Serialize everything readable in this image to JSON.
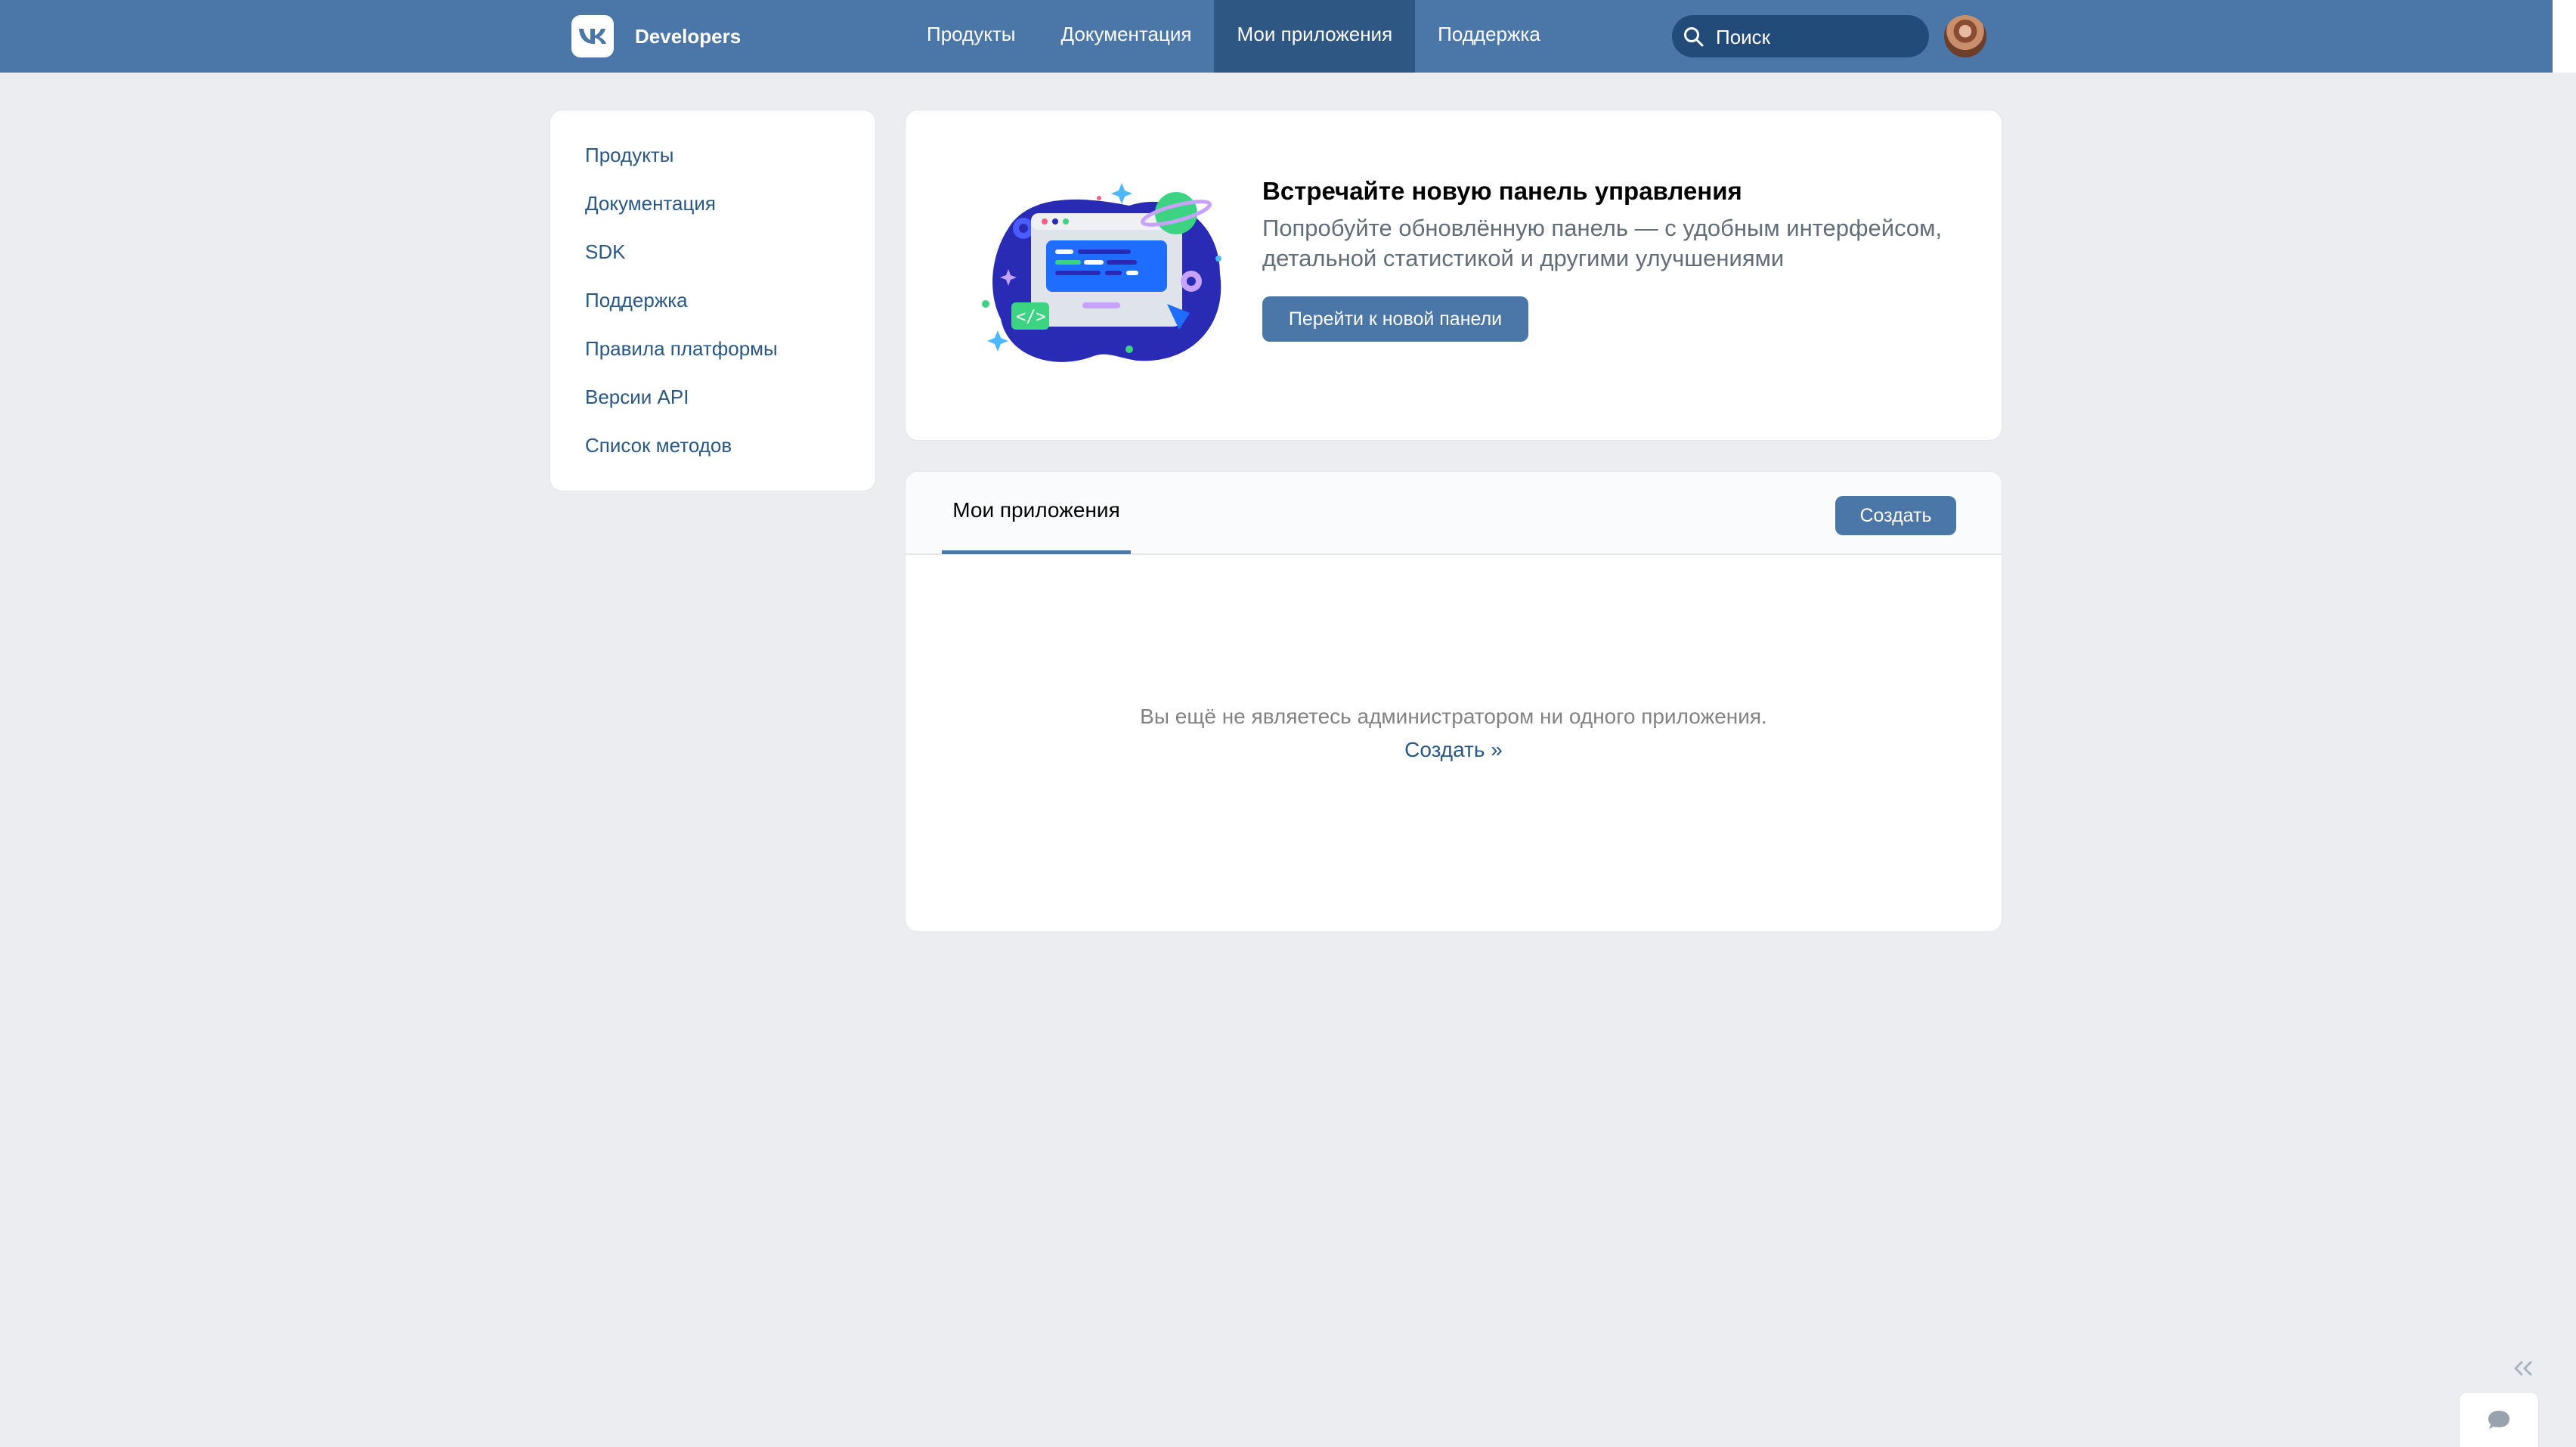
{
  "header": {
    "logo_label": "Developers",
    "nav": [
      {
        "label": "Продукты"
      },
      {
        "label": "Документация"
      },
      {
        "label": "Мои приложения",
        "active": true
      },
      {
        "label": "Поддержка"
      }
    ],
    "search_placeholder": "Поиск",
    "colors": {
      "bar": "#4a76a8",
      "active_nav": "#2f5783",
      "search_bg": "#224b7a"
    }
  },
  "sidebar": {
    "items": [
      {
        "label": "Продукты"
      },
      {
        "label": "Документация"
      },
      {
        "label": "SDK"
      },
      {
        "label": "Поддержка"
      },
      {
        "label": "Правила платформы"
      },
      {
        "label": "Версии API"
      },
      {
        "label": "Список методов"
      }
    ]
  },
  "promo": {
    "title": "Встречайте новую панель управления",
    "description": "Попробуйте обновлённую панель — с удобным интерфейсом, детальной статистикой и другими улучшениями",
    "button_label": "Перейти к новой панели"
  },
  "apps": {
    "tab_label": "Мои приложения",
    "create_button_label": "Создать",
    "empty_text": "Вы ещё не являетесь администратором ни одного приложения.",
    "empty_link": "Создать »"
  },
  "widgets": {
    "collapse_icon": "double-chevron-left-icon",
    "chat_icon": "chat-bubble-icon"
  }
}
